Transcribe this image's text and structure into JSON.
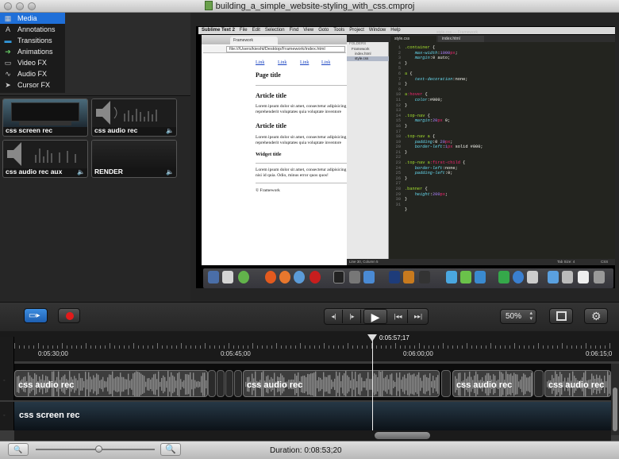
{
  "window": {
    "title": "building_a_simple_website-styling_with_css.cmproj"
  },
  "tabs": [
    {
      "label": "Media",
      "icon": "media-icon",
      "active": true
    },
    {
      "label": "Annotations",
      "icon": "annotations-icon",
      "active": false
    },
    {
      "label": "Transitions",
      "icon": "transitions-icon",
      "active": false
    },
    {
      "label": "Animations",
      "icon": "animations-icon",
      "active": false
    },
    {
      "label": "Video FX",
      "icon": "video-fx-icon",
      "active": false
    },
    {
      "label": "Audio FX",
      "icon": "audio-fx-icon",
      "active": false
    },
    {
      "label": "Cursor FX",
      "icon": "cursor-fx-icon",
      "active": false
    }
  ],
  "clips": [
    {
      "label": "css screen rec",
      "kind": "video"
    },
    {
      "label": "css audio rec",
      "kind": "audio"
    },
    {
      "label": "css audio rec aux",
      "kind": "audio"
    },
    {
      "label": "RENDER",
      "kind": "audio"
    }
  ],
  "preview": {
    "menubar": [
      "Sublime Text 2",
      "File",
      "Edit",
      "Selection",
      "Find",
      "View",
      "Goto",
      "Tools",
      "Project",
      "Window",
      "Help"
    ],
    "editor_title": "style.css — Framework",
    "browser_tab": "Framework",
    "url": "file:///Users/kiesht/Desktop/Framework/index.html",
    "web_links": [
      "Link",
      "Link",
      "Link",
      "Link"
    ],
    "page_title": "Page title",
    "article_title_1": "Article title",
    "article_text_1": "Lorem ipsum dolor sit amet, consectetur adipisicing",
    "article_text_1b": "reprehenderit voluptates quia voluptate inventore",
    "article_title_2": "Article title",
    "article_text_2": "Lorem ipsum dolor sit amet, consectetur adipisicing",
    "article_text_2b": "reprehenderit voluptates quia voluptate inventore",
    "widget_title": "Widget title",
    "widget_text": "Lorem ipsum dolor sit amet, consectetur adipisicing",
    "widget_text_b": "nisi id quia. Odio, minus error quos quos!",
    "footer": "© Framework",
    "folders_label": "FOLDERS",
    "folder_items": [
      "Framework",
      "index.html",
      "style.css"
    ],
    "editor_tabs": [
      "style.css",
      "index.html"
    ],
    "status_left": "Line 30, Column 5",
    "status_right": "Tab Size: 4",
    "status_lang": "CSS",
    "line_numbers": "1\n2\n3\n4\n5\n6\n7\n8\n9\n10\n11\n12\n13\n14\n15\n16\n17\n18\n19\n20\n21\n22\n23\n24\n25\n26\n27\n28\n29\n30\n31",
    "code": ".container {\n    max-width:1000px;\n    margin:0 auto;\n}\n\na {\n    text-decoration:none;\n}\n\na:hover {\n    color:#000;\n}\n\n.top-nav {\n    margin:20px 0;\n}\n\n.top-nav a {\n    padding:0 20px;\n    border-left:1px solid #000;\n}\n\n.top-nav a:first-child {\n    border-left:none;\n    padding-left:0;\n}\n\n.banner {\n    height:200px;\n}\n\n}"
  },
  "toolbar": {
    "record_screen_icon": "record-screen-icon",
    "record_icon": "record-icon",
    "zoom": "50%",
    "crop_icon": "crop-icon",
    "settings_icon": "gear-icon"
  },
  "timeline": {
    "playhead_time": "0:05:57;17",
    "ruler_labels": [
      "0:05:30;00",
      "0:05:45;00",
      "0:06:00;00",
      "0:06:15;0"
    ],
    "track1_clips": [
      "css audio rec",
      "css audio rec",
      "css audio rec",
      "css audio rec"
    ],
    "track2_clip": "css screen rec"
  },
  "bottom": {
    "duration": "Duration: 0:08:53;20",
    "zoom_slider": 0.5
  }
}
